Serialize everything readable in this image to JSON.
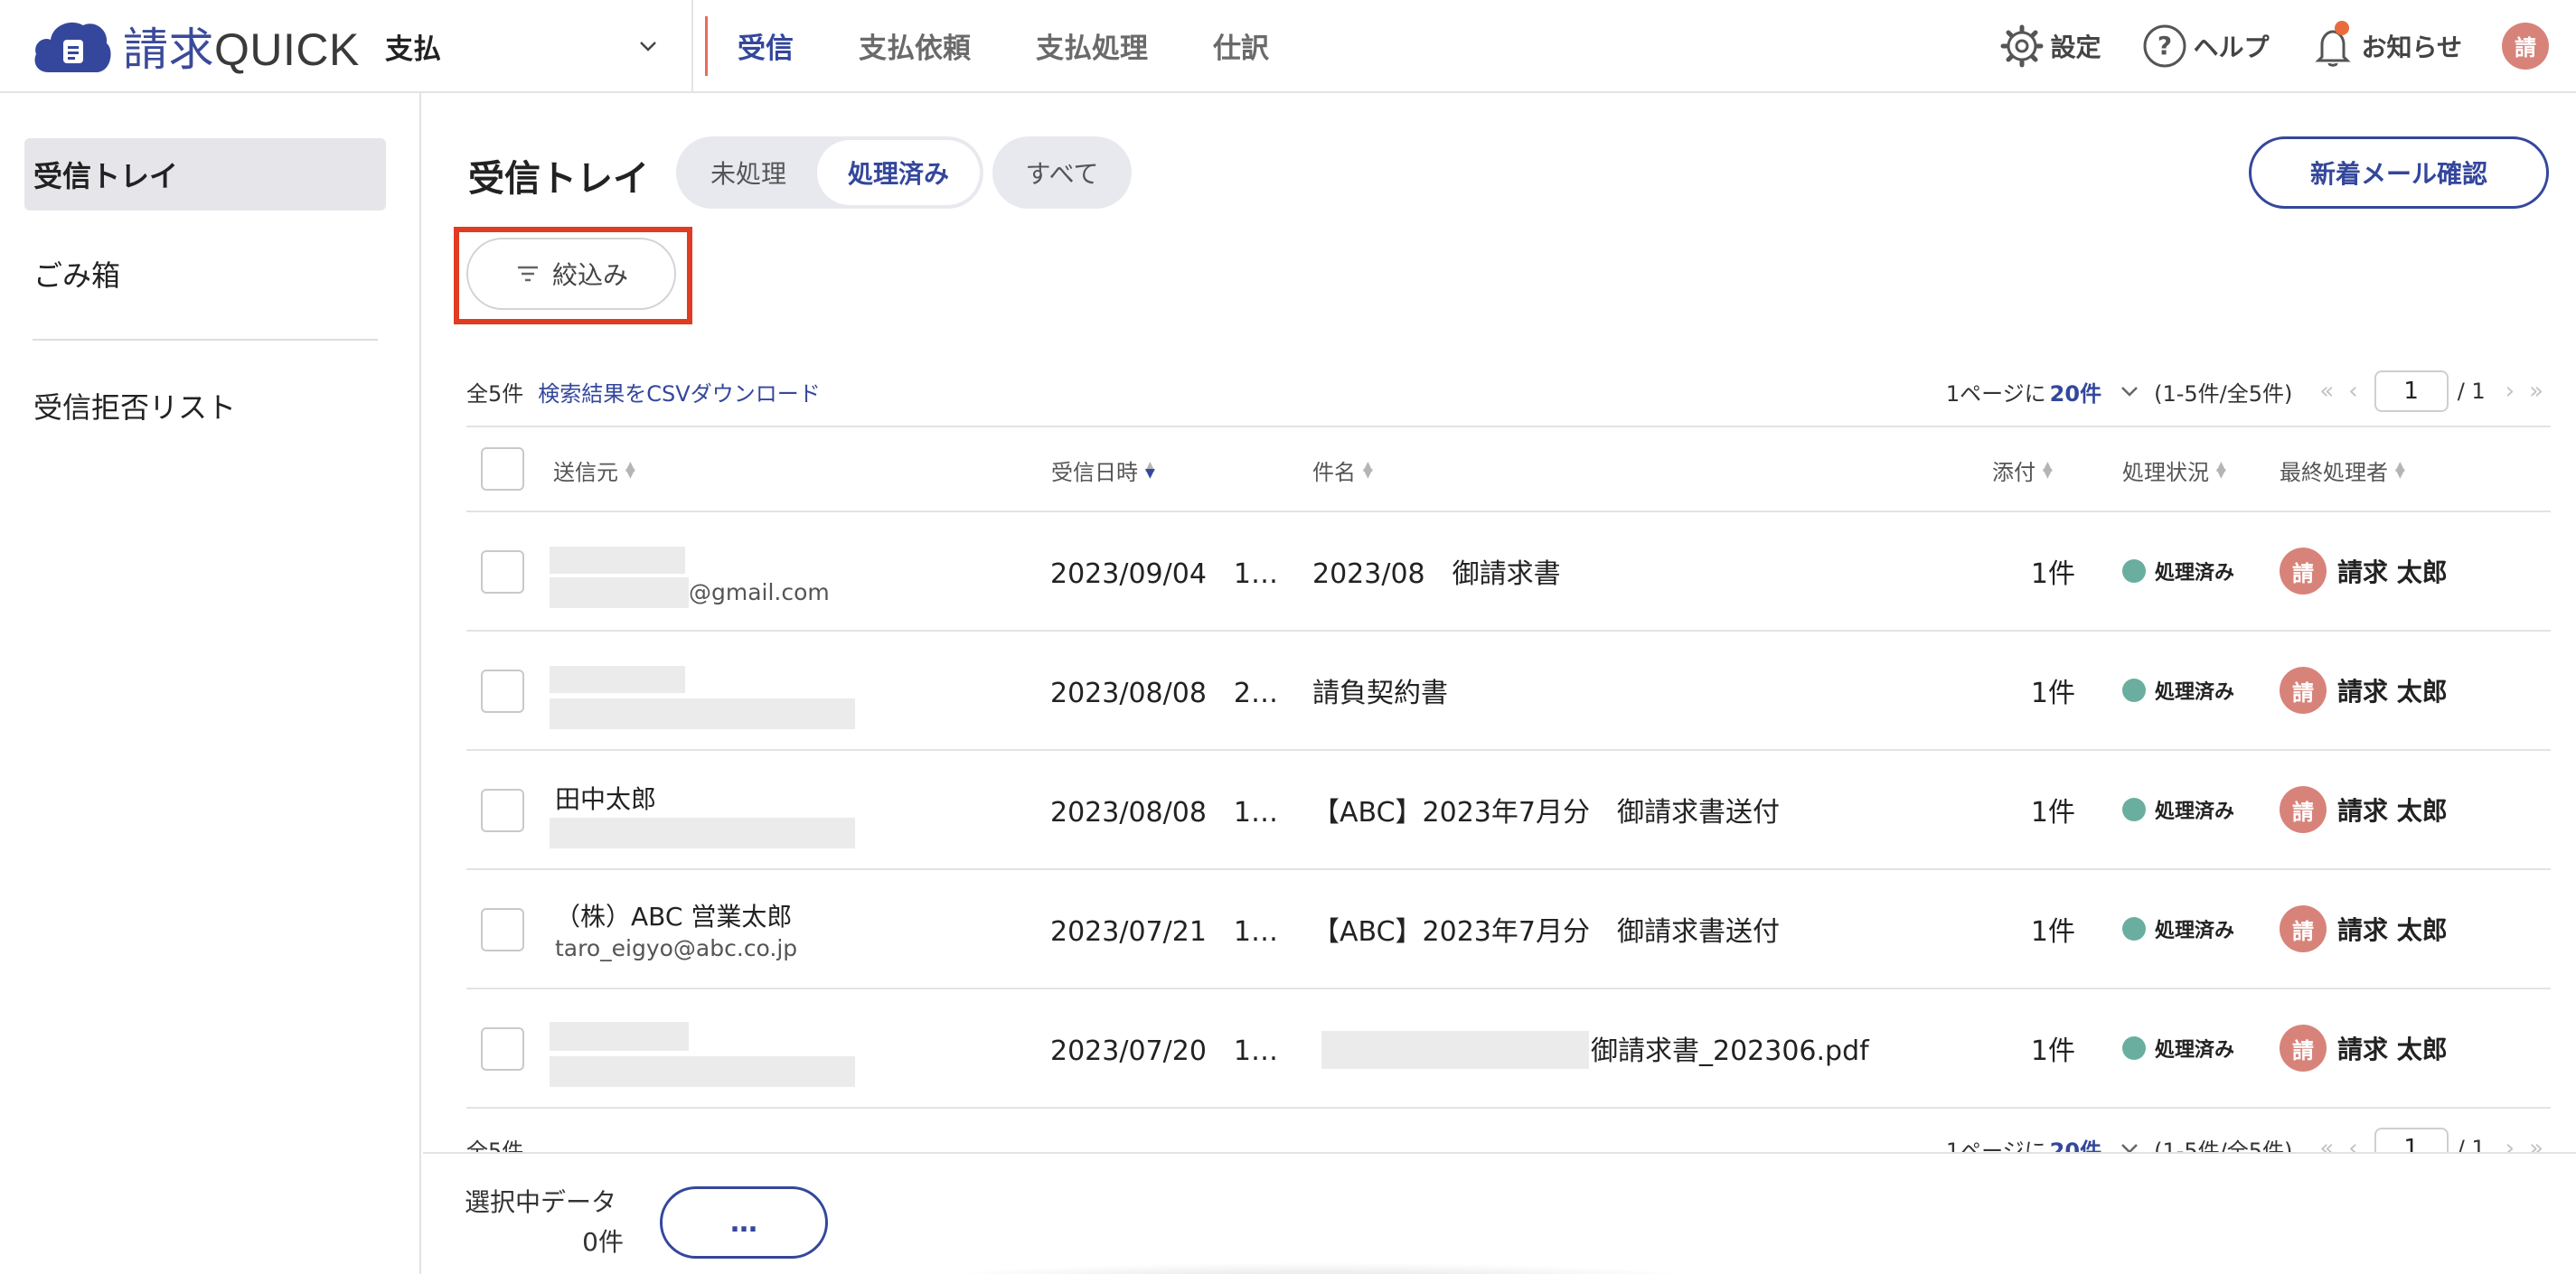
{
  "header": {
    "logo_text": "請求",
    "logo_text_suffix": "QUICK",
    "org_select": "支払",
    "tabs": [
      {
        "label": "受信",
        "active": true
      },
      {
        "label": "支払依頼",
        "active": false
      },
      {
        "label": "支払処理",
        "active": false
      },
      {
        "label": "仕訳",
        "active": false
      }
    ],
    "settings_label": "設定",
    "help_label": "ヘルプ",
    "notifications_label": "お知らせ",
    "avatar_initial": "請",
    "accent_color": "#34479c",
    "icons": [
      "cloud-logo-icon",
      "chevron-down-icon",
      "gear-icon",
      "help-circle-icon",
      "bell-icon"
    ]
  },
  "sidebar": {
    "items": [
      {
        "label": "受信トレイ",
        "active": true
      },
      {
        "label": "ごみ箱",
        "active": false
      },
      {
        "label": "受信拒否リスト",
        "active": false
      }
    ]
  },
  "main": {
    "title": "受信トレイ",
    "segments": [
      {
        "label": "未処理",
        "active": false
      },
      {
        "label": "処理済み",
        "active": true
      }
    ],
    "segment_all": "すべて",
    "new_mail_button": "新着メール確認",
    "filter_button": "絞込み",
    "total_count": "全5件",
    "csv_link": "検索結果をCSVダウンロード",
    "pager": {
      "per_page_prefix": "1ページに",
      "per_page_value": "20件",
      "range": "(1-5件/全5件)",
      "page": "1",
      "total_pages": "/ 1"
    },
    "columns": {
      "sender": "送信元",
      "received": "受信日時",
      "subject": "件名",
      "attachments": "添付",
      "status": "処理状況",
      "last_processor": "最終処理者"
    },
    "rows": [
      {
        "name": "",
        "email": "@gmail.com",
        "received": "2023/09/04　1…",
        "subject": "2023/08　御請求書",
        "attachments": "1件",
        "status": "処理済み",
        "processor": "請求 太郎",
        "processor_initial": "請"
      },
      {
        "name": "",
        "email": "",
        "received": "2023/08/08　2…",
        "subject": "請負契約書",
        "attachments": "1件",
        "status": "処理済み",
        "processor": "請求 太郎",
        "processor_initial": "請"
      },
      {
        "name": "田中太郎",
        "email": "",
        "received": "2023/08/08　1…",
        "subject": "【ABC】2023年7月分　御請求書送付",
        "attachments": "1件",
        "status": "処理済み",
        "processor": "請求 太郎",
        "processor_initial": "請"
      },
      {
        "name": "（株）ABC 営業太郎",
        "email": "taro_eigyo@abc.co.jp",
        "received": "2023/07/21　1…",
        "subject": "【ABC】2023年7月分　御請求書送付",
        "attachments": "1件",
        "status": "処理済み",
        "processor": "請求 太郎",
        "processor_initial": "請"
      },
      {
        "name": "",
        "email": "",
        "received": "2023/07/20　1…",
        "subject": "御請求書_202306.pdf",
        "attachments": "1件",
        "status": "処理済み",
        "processor": "請求 太郎",
        "processor_initial": "請"
      }
    ],
    "status_color": "#6aaea0"
  },
  "action_bar": {
    "selected_label": "選択中データ",
    "selected_count": "0件",
    "more_button": "…"
  }
}
